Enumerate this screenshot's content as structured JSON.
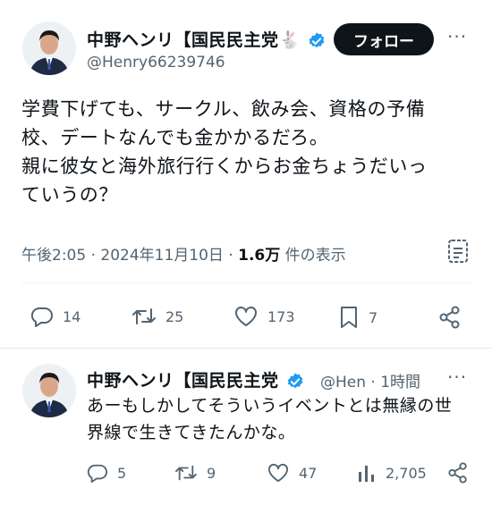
{
  "main_tweet": {
    "author_name": "中野ヘンリ【国民民主党🐇",
    "handle": "@Henry66239746",
    "follow_label": "フォロー",
    "more": "···",
    "text_lines": [
      "学費下げても、サークル、飲み会、資格の予備",
      "校、デートなんでも金かかるだろ。",
      "親に彼女と海外旅行行くからお金ちょうだいっ",
      "ていうの？"
    ],
    "timestamp": "午後2:05 · 2024年11月10日 · ",
    "views_count": "1.6万",
    "views_label": " 件の表示",
    "actions": {
      "replies": "14",
      "retweets": "25",
      "likes": "173",
      "bookmarks": "7"
    }
  },
  "reply_tweet": {
    "author_name": "中野ヘンリ【国民民主党",
    "handle_time": "@Hen · 1時間",
    "more": "···",
    "text_lines": [
      "あーもしかしてそういうイベントとは無縁の世",
      "界線で生きてきたんかな。"
    ],
    "actions": {
      "replies": "5",
      "retweets": "9",
      "likes": "47",
      "views": "2,705"
    }
  },
  "colors": {
    "verified_blue": "#1d9bf0",
    "text_primary": "#0f1419",
    "text_secondary": "#536471"
  }
}
